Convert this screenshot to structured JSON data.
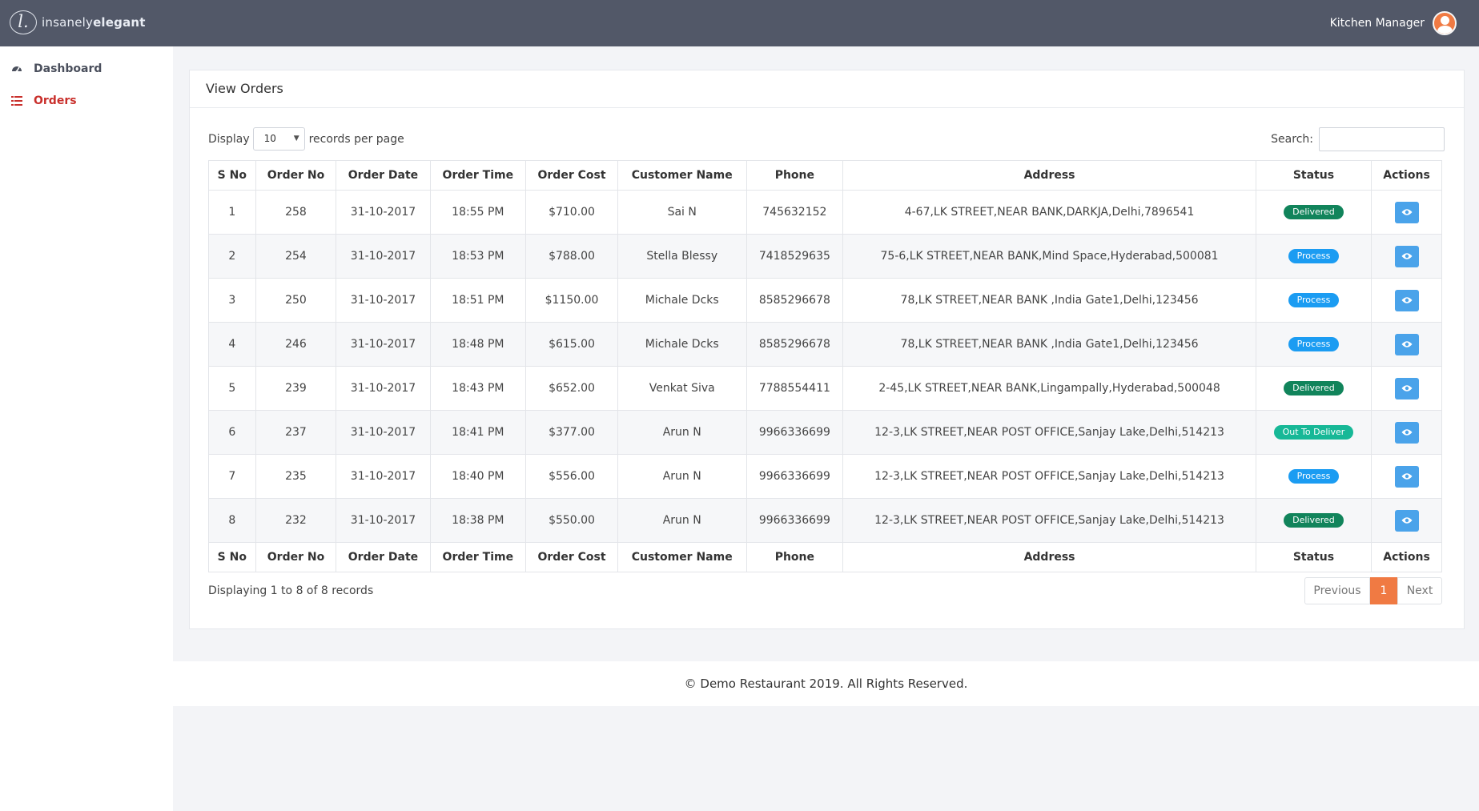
{
  "brand": {
    "logo_letter": "l.",
    "name_light": "insanely",
    "name_bold": "elegant"
  },
  "user": {
    "name": "Kitchen Manager",
    "avatar_icon": "user-avatar-icon"
  },
  "sidebar": {
    "items": [
      {
        "label": "Dashboard",
        "icon": "dashboard-icon",
        "active": false
      },
      {
        "label": "Orders",
        "icon": "list-icon",
        "active": true
      }
    ]
  },
  "card": {
    "title": "View Orders"
  },
  "controls": {
    "display_label": "Display",
    "page_size": "10",
    "records_label": "records per page",
    "search_label": "Search:",
    "search_value": ""
  },
  "table": {
    "columns": [
      "S No",
      "Order No",
      "Order Date",
      "Order Time",
      "Order Cost",
      "Customer Name",
      "Phone",
      "Address",
      "Status",
      "Actions"
    ],
    "rows": [
      {
        "sno": "1",
        "order_no": "258",
        "date": "31-10-2017",
        "time": "18:55 PM",
        "cost": "$710.00",
        "customer": "Sai N",
        "phone": "745632152",
        "address": "4-67,LK STREET,NEAR BANK,DARKJA,Delhi,7896541",
        "status": "Delivered"
      },
      {
        "sno": "2",
        "order_no": "254",
        "date": "31-10-2017",
        "time": "18:53 PM",
        "cost": "$788.00",
        "customer": "Stella Blessy",
        "phone": "7418529635",
        "address": "75-6,LK STREET,NEAR BANK,Mind Space,Hyderabad,500081",
        "status": "Process"
      },
      {
        "sno": "3",
        "order_no": "250",
        "date": "31-10-2017",
        "time": "18:51 PM",
        "cost": "$1150.00",
        "customer": "Michale Dcks",
        "phone": "8585296678",
        "address": "78,LK STREET,NEAR BANK ,India Gate1,Delhi,123456",
        "status": "Process"
      },
      {
        "sno": "4",
        "order_no": "246",
        "date": "31-10-2017",
        "time": "18:48 PM",
        "cost": "$615.00",
        "customer": "Michale Dcks",
        "phone": "8585296678",
        "address": "78,LK STREET,NEAR BANK ,India Gate1,Delhi,123456",
        "status": "Process"
      },
      {
        "sno": "5",
        "order_no": "239",
        "date": "31-10-2017",
        "time": "18:43 PM",
        "cost": "$652.00",
        "customer": "Venkat Siva",
        "phone": "7788554411",
        "address": "2-45,LK STREET,NEAR BANK,Lingampally,Hyderabad,500048",
        "status": "Delivered"
      },
      {
        "sno": "6",
        "order_no": "237",
        "date": "31-10-2017",
        "time": "18:41 PM",
        "cost": "$377.00",
        "customer": "Arun N",
        "phone": "9966336699",
        "address": "12-3,LK STREET,NEAR POST OFFICE,Sanjay Lake,Delhi,514213",
        "status": "Out To Deliver"
      },
      {
        "sno": "7",
        "order_no": "235",
        "date": "31-10-2017",
        "time": "18:40 PM",
        "cost": "$556.00",
        "customer": "Arun N",
        "phone": "9966336699",
        "address": "12-3,LK STREET,NEAR POST OFFICE,Sanjay Lake,Delhi,514213",
        "status": "Process"
      },
      {
        "sno": "8",
        "order_no": "232",
        "date": "31-10-2017",
        "time": "18:38 PM",
        "cost": "$550.00",
        "customer": "Arun N",
        "phone": "9966336699",
        "address": "12-3,LK STREET,NEAR POST OFFICE,Sanjay Lake,Delhi,514213",
        "status": "Delivered"
      }
    ]
  },
  "status_colors": {
    "Delivered": "#11845b",
    "Process": "#1b9cf2",
    "Out To Deliver": "#17b897"
  },
  "info": "Displaying 1 to 8 of 8 records",
  "pagination": {
    "previous": "Previous",
    "current": "1",
    "next": "Next"
  },
  "footer": "© Demo Restaurant 2019. All Rights Reserved.",
  "colors": {
    "topbar": "#525868",
    "accent": "#f07a43",
    "active_nav": "#c9302c",
    "view_button": "#4aa3ea"
  }
}
